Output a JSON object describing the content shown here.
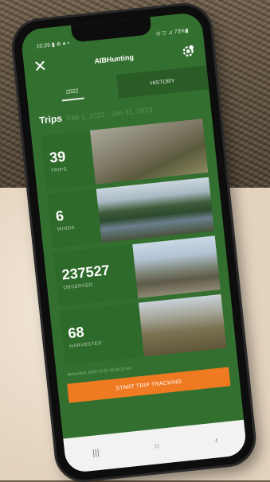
{
  "status_bar": {
    "left": "10:26 ▮ ⊕ ● •",
    "right": "⊙ ▽ ⊿ 73%▮"
  },
  "app": {
    "title": "AIBHunting",
    "close_icon": "close-icon",
    "settings_icon": "gear-icon"
  },
  "tabs": [
    {
      "label": "2022",
      "active": true
    },
    {
      "label": "HISTORY",
      "active": false
    }
  ],
  "trips": {
    "title": "Trips",
    "date_range": "Feb 1, 2022 - Jan 31, 2023"
  },
  "stats": [
    {
      "value": "39",
      "label": "TRIPS"
    },
    {
      "value": "6",
      "label": "WINDS"
    },
    {
      "value": "237527",
      "label": "OBSERVED"
    },
    {
      "value": "68",
      "label": "HARVESTED"
    }
  ],
  "refreshed": "Refreshed: 2022-12-21 10:26:13 am",
  "cta": {
    "label": "START TRIP TRACKING"
  },
  "nav": {
    "recent": "|||",
    "home": "○",
    "back": "‹"
  },
  "colors": {
    "app_green": "#33702f",
    "card_green": "#2e6a2a",
    "cta_orange": "#f07a22"
  }
}
